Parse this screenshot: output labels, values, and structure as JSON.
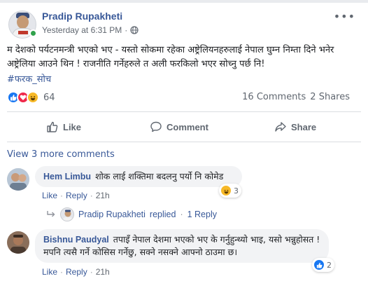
{
  "post": {
    "author": "Pradip Rupakheti",
    "timestamp": "Yesterday at 6:31 PM",
    "dot": "·",
    "audience_icon": "globe-icon",
    "more_icon_glyph": "•••",
    "text": "म देशको पर्यटनमन्त्री भएको भए - यस्तो सोकमा रहेका अष्ट्रेलियनहरुलाई नेपाल घुम्न निम्ता दिने भनेर अष्ट्रेलिया आउने थिन ! राजनीति गर्नेहरुले त अली फरकिलो भएर सोच्नु पर्छ नि!",
    "hashtag": "#फरक_सोच",
    "reaction_count": "64",
    "comments_count": "16 Comments",
    "shares_count": "2 Shares"
  },
  "actions": {
    "like": "Like",
    "comment": "Comment",
    "share": "Share"
  },
  "comments_section": {
    "view_more": "View 3 more comments",
    "comments": [
      {
        "author": "Hem Limbu",
        "text": "शोक लाई शक्तिमा बदलनु पर्यो नि कोमेड",
        "like_label": "Like",
        "reply_label": "Reply",
        "time": "21h",
        "reaction_count": "3",
        "reaction_icon": "haha-icon"
      },
      {
        "author": "Bishnu Paudyal",
        "text": "तपाइँ नेपाल देशमा भएको भए के गर्नुहुन्थ्यो भाइ, यसो भन्नुहोसत ! मपनि त्यसै गर्ने कोसिस गर्नेछु, सक्ने नसक्ने आफ्नो ठाउमा छ।",
        "like_label": "Like",
        "reply_label": "Reply",
        "time": "21h",
        "reaction_count": "2",
        "reaction_icon": "like-icon"
      }
    ],
    "reply_summary": {
      "author": "Pradip Rupakheti",
      "replied": "replied",
      "count": "1 Reply"
    }
  },
  "colors": {
    "link_blue": "#385898",
    "like_blue": "#1877f2",
    "love_red": "#f0284a",
    "haha_yellow": "#f7b928",
    "online_green": "#31a24c",
    "secondary_text": "#606770",
    "bubble_bg": "#f2f3f5"
  }
}
